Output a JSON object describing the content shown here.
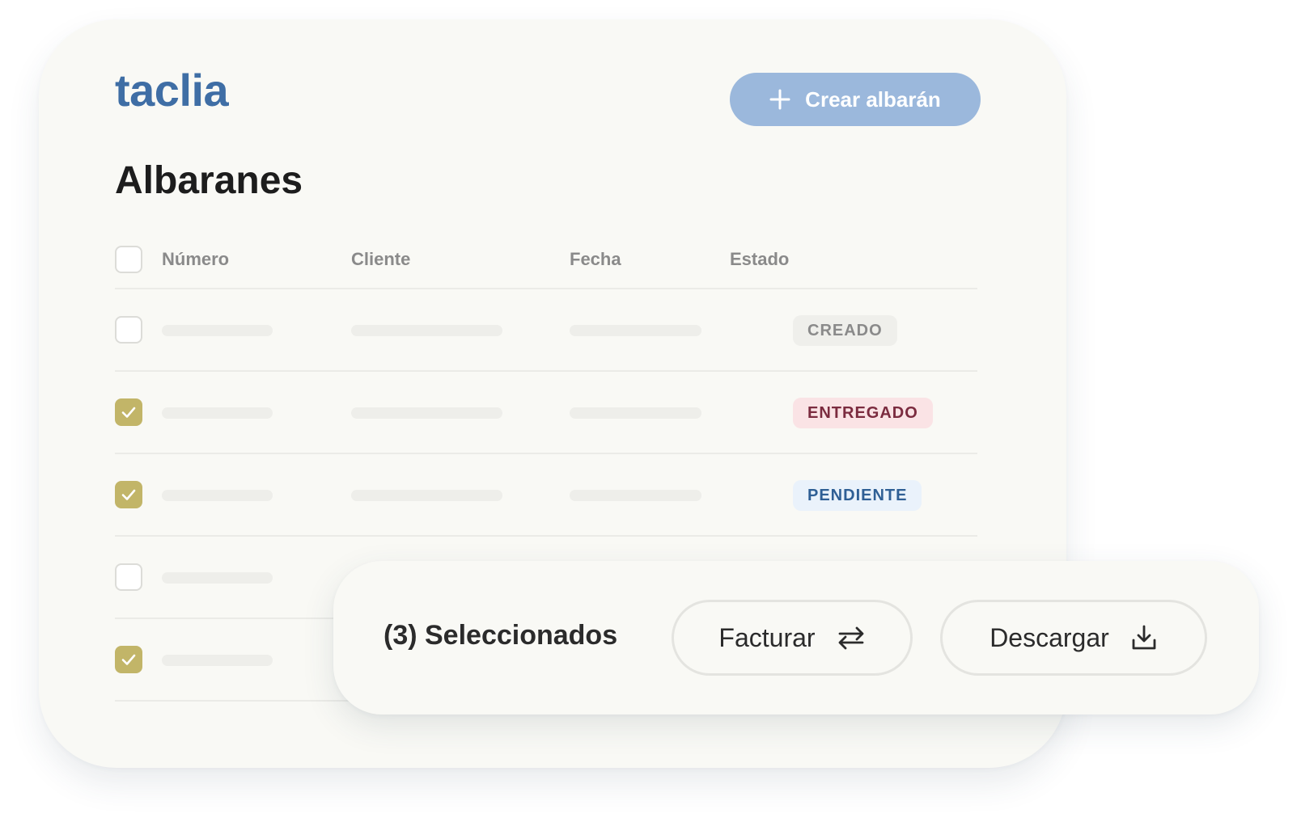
{
  "brand": {
    "logo_text": "taclia",
    "primary_color": "#3f6ea5"
  },
  "header": {
    "create_button_label": "Crear albarán",
    "create_button_icon": "plus-icon",
    "create_button_color": "#9bb8dc"
  },
  "page": {
    "title": "Albaranes"
  },
  "table": {
    "columns": [
      "Número",
      "Cliente",
      "Fecha",
      "Estado"
    ],
    "header_checked": false,
    "rows": [
      {
        "checked": false,
        "status": "CREADO",
        "status_type": "creado"
      },
      {
        "checked": true,
        "status": "ENTREGADO",
        "status_type": "entregado"
      },
      {
        "checked": true,
        "status": "PENDIENTE",
        "status_type": "pendiente"
      },
      {
        "checked": false,
        "status": "",
        "status_type": ""
      },
      {
        "checked": true,
        "status": "",
        "status_type": ""
      }
    ],
    "checkbox_checked_color": "#c2b568",
    "status_colors": {
      "creado": {
        "bg": "#efefeb",
        "fg": "#8a8a8a"
      },
      "entregado": {
        "bg": "#fae3e5",
        "fg": "#7b2b3f"
      },
      "pendiente": {
        "bg": "#eaf2fb",
        "fg": "#2f5f95"
      }
    }
  },
  "action_bar": {
    "selected_label": "(3) Seleccionados",
    "invoice_button_label": "Facturar",
    "invoice_button_icon": "swap-arrows-icon",
    "download_button_label": "Descargar",
    "download_button_icon": "download-icon"
  }
}
